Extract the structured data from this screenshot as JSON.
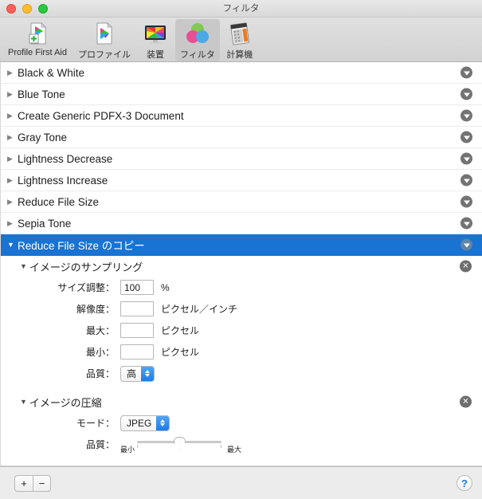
{
  "window": {
    "title": "フィルタ",
    "traffic_lights": [
      "close-button",
      "minimize-button",
      "zoom-button"
    ]
  },
  "toolbar": {
    "items": [
      {
        "label": "Profile First Aid",
        "icon": "profile-first-aid-icon",
        "selected": false
      },
      {
        "label": "プロファイル",
        "icon": "profiles-icon",
        "selected": false
      },
      {
        "label": "装置",
        "icon": "devices-icon",
        "selected": false
      },
      {
        "label": "フィルタ",
        "icon": "filters-icon",
        "selected": true
      },
      {
        "label": "計算機",
        "icon": "calculator-icon",
        "selected": false
      }
    ]
  },
  "filter_list": {
    "rows": [
      {
        "label": "Black & White",
        "expanded": false,
        "selected": false
      },
      {
        "label": "Blue Tone",
        "expanded": false,
        "selected": false
      },
      {
        "label": "Create Generic PDFX-3 Document",
        "expanded": false,
        "selected": false
      },
      {
        "label": "Gray Tone",
        "expanded": false,
        "selected": false
      },
      {
        "label": "Lightness Decrease",
        "expanded": false,
        "selected": false
      },
      {
        "label": "Lightness Increase",
        "expanded": false,
        "selected": false
      },
      {
        "label": "Reduce File Size",
        "expanded": false,
        "selected": false
      },
      {
        "label": "Sepia Tone",
        "expanded": false,
        "selected": false
      },
      {
        "label": "Reduce File Size のコピー",
        "expanded": true,
        "selected": true
      }
    ],
    "collapsed_triangle": "▶",
    "expanded_triangle": "▼",
    "row_action_icon": "popup-menu-icon"
  },
  "detail": {
    "sampling_section": {
      "title": "イメージのサンプリング",
      "triangle": "▼",
      "delete_icon": "remove-section-icon",
      "fields": [
        {
          "label": "サイズ調整：",
          "value": "100",
          "placeholder": "",
          "unit": "%",
          "name": "scale-field"
        },
        {
          "label": "解像度：",
          "value": "",
          "placeholder": "",
          "unit": "ピクセル／インチ",
          "name": "resolution-field"
        },
        {
          "label": "最大：",
          "value": "",
          "placeholder": "",
          "unit": "ピクセル",
          "name": "max-field"
        },
        {
          "label": "最小：",
          "value": "",
          "placeholder": "",
          "unit": "ピクセル",
          "name": "min-field"
        }
      ],
      "quality": {
        "label": "品質：",
        "value": "高"
      }
    },
    "compression_section": {
      "title": "イメージの圧縮",
      "triangle": "▼",
      "delete_icon": "remove-section-icon",
      "mode": {
        "label": "モード：",
        "value": "JPEG"
      },
      "quality": {
        "label": "品質：",
        "min_label": "最小",
        "max_label": "最大",
        "value_percent": 50
      }
    }
  },
  "bottom_bar": {
    "add_label": "+",
    "remove_label": "−",
    "help_label": "?"
  },
  "colors": {
    "selection_blue": "#1873d3",
    "popup_blue": "#1e7ae8",
    "help_blue": "#1978e0",
    "row_action_gray": "#737373"
  }
}
